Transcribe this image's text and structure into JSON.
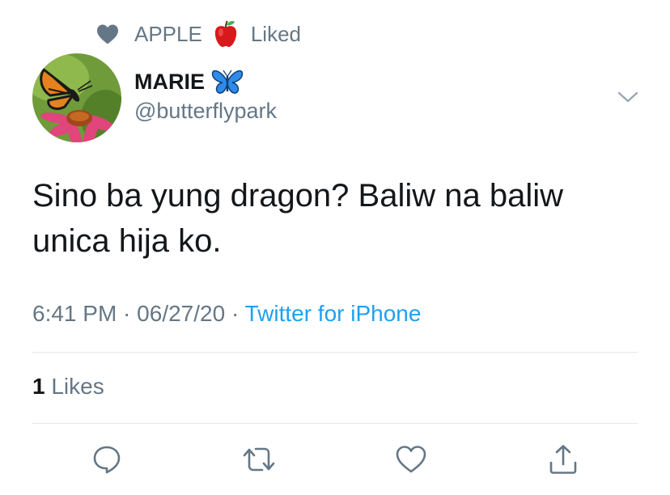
{
  "social_context": {
    "icon": "heart-icon",
    "liker_name": "APPLE",
    "emoji": "apple-emoji",
    "action": "Liked"
  },
  "tweet": {
    "author": {
      "display_name": "MARIE",
      "name_emoji": "butterfly-emoji",
      "handle": "@butterflypark",
      "avatar": "monarch-butterfly-on-coneflower"
    },
    "text_line1": "Sino ba yung dragon? Baliw na baliw",
    "text_line2": "unica hija ko.",
    "time": "6:41 PM",
    "separator1": " · ",
    "date": "06/27/20",
    "separator2": " · ",
    "source": "Twitter for iPhone",
    "likes_count": "1",
    "likes_label": " Likes"
  },
  "actions": [
    "reply-icon",
    "retweet-icon",
    "like-icon",
    "share-icon"
  ],
  "colors": {
    "text": "#14171a",
    "secondary": "#657786",
    "link": "#1da1f2",
    "divider": "#e1e8ed",
    "icon": "#657786"
  }
}
